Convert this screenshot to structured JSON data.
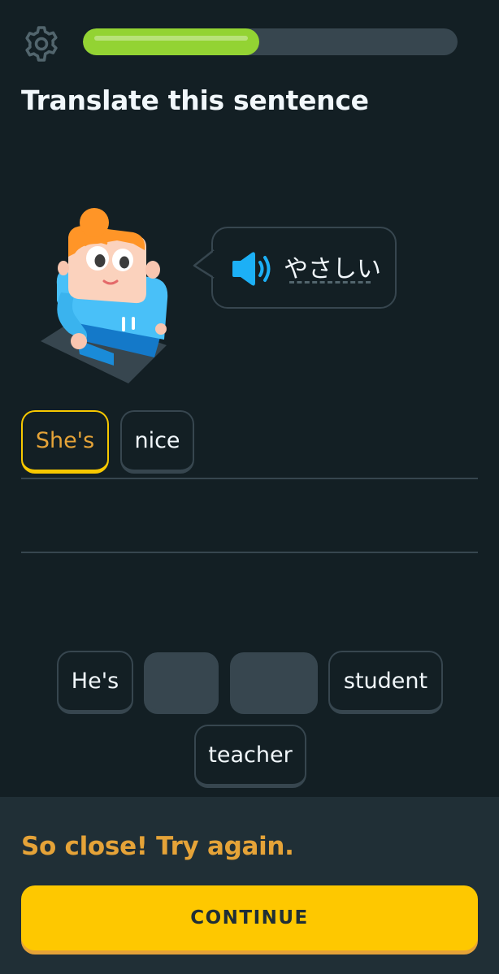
{
  "header": {
    "settings_icon": "gear-icon",
    "progress_fraction": 0.47
  },
  "prompt": {
    "title": "Translate this sentence"
  },
  "speech": {
    "speaker_icon": "speaker-icon",
    "phrase": "やさしい"
  },
  "answer": {
    "chips": [
      {
        "label": "She's",
        "state": "selected"
      },
      {
        "label": "nice",
        "state": "normal"
      }
    ]
  },
  "word_bank": {
    "chips": [
      {
        "label": "He's",
        "state": "available"
      },
      {
        "label": "",
        "state": "used"
      },
      {
        "label": "",
        "state": "used"
      },
      {
        "label": "student",
        "state": "available"
      },
      {
        "label": "teacher",
        "state": "available"
      }
    ]
  },
  "footer": {
    "feedback": "So close! Try again.",
    "continue_label": "CONTINUE"
  },
  "colors": {
    "background": "#131f24",
    "progress": "#93d333",
    "accent": "#fec800",
    "feedback": "#e5a338",
    "speaker": "#1cb0f6"
  }
}
